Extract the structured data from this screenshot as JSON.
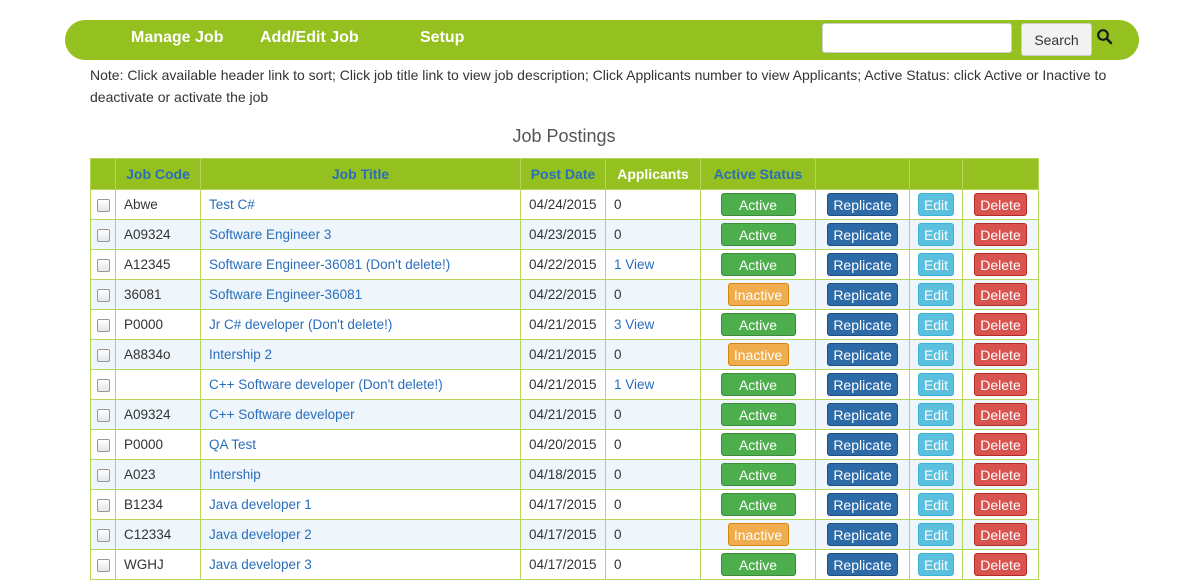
{
  "nav": {
    "links": [
      "Manage Job",
      "Add/Edit Job",
      "Setup"
    ],
    "search_value": "",
    "search_button": "Search"
  },
  "note": "Note: Click available header link to sort; Click job title link to view job description; Click Applicants number to view Applicants; Active Status: click Active or Inactive to deactivate or activate the job",
  "table": {
    "title": "Job Postings",
    "headers": [
      "",
      "Job Code",
      "Job Title",
      "Post Date",
      "Applicants",
      "Active Status",
      "",
      "",
      ""
    ],
    "replicate_label": "Replicate",
    "edit_label": "Edit",
    "delete_label": "Delete",
    "rows": [
      {
        "code": "Abwe",
        "title": "Test C#",
        "date": "04/24/2015",
        "applicants": "0",
        "status": "Active"
      },
      {
        "code": "A09324",
        "title": "Software Engineer 3",
        "date": "04/23/2015",
        "applicants": "0",
        "status": "Active"
      },
      {
        "code": "A12345",
        "title": "Software Engineer-36081 (Don't delete!)",
        "date": "04/22/2015",
        "applicants": "1 View",
        "status": "Active"
      },
      {
        "code": "36081",
        "title": "Software Engineer-36081",
        "date": "04/22/2015",
        "applicants": "0",
        "status": "Inactive"
      },
      {
        "code": "P0000",
        "title": "Jr C# developer (Don't delete!)",
        "date": "04/21/2015",
        "applicants": "3 View",
        "status": "Active"
      },
      {
        "code": "A8834o",
        "title": "Intership 2",
        "date": "04/21/2015",
        "applicants": "0",
        "status": "Inactive"
      },
      {
        "code": "",
        "title": "C++ Software developer (Don't delete!)",
        "date": "04/21/2015",
        "applicants": "1 View",
        "status": "Active"
      },
      {
        "code": "A09324",
        "title": "C++ Software developer",
        "date": "04/21/2015",
        "applicants": "0",
        "status": "Active"
      },
      {
        "code": "P0000",
        "title": "QA Test",
        "date": "04/20/2015",
        "applicants": "0",
        "status": "Active"
      },
      {
        "code": "A023",
        "title": "Intership",
        "date": "04/18/2015",
        "applicants": "0",
        "status": "Active"
      },
      {
        "code": "B1234",
        "title": "Java developer 1",
        "date": "04/17/2015",
        "applicants": "0",
        "status": "Active"
      },
      {
        "code": "C12334",
        "title": "Java developer 2",
        "date": "04/17/2015",
        "applicants": "0",
        "status": "Inactive"
      },
      {
        "code": "WGHJ",
        "title": "Java developer 3",
        "date": "04/17/2015",
        "applicants": "0",
        "status": "Active"
      }
    ]
  }
}
